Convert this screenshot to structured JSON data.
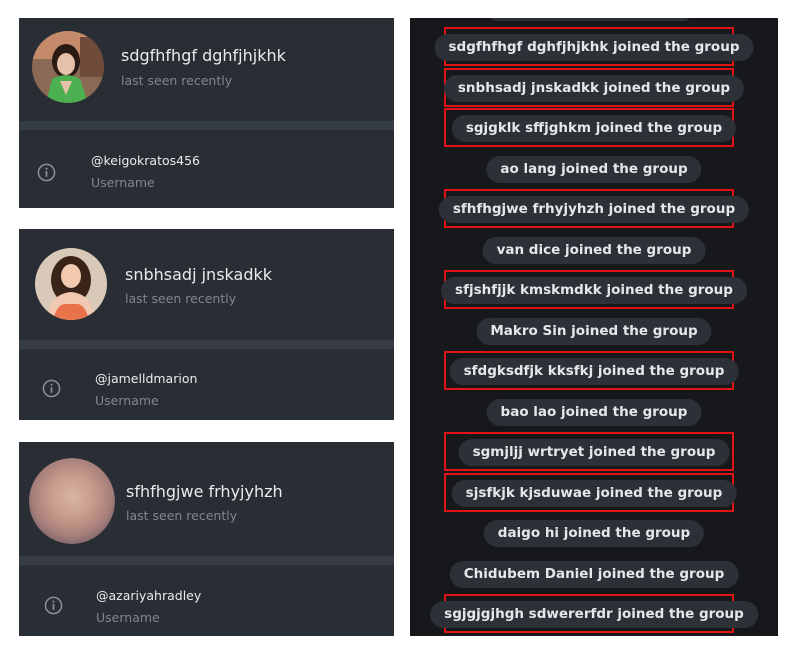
{
  "profiles": [
    {
      "name": "sdgfhfhgf dghfjhjkhk",
      "status": "last seen recently",
      "handle": "@keigokratos456",
      "handle_label": "Username"
    },
    {
      "name": "snbhsadj jnskadkk",
      "status": "last seen recently",
      "handle": "@jamelldmarion",
      "handle_label": "Username"
    },
    {
      "name": "sfhfhgjwe frhyjyhzh",
      "status": "last seen recently",
      "handle": "@azariyahradley",
      "handle_label": "Username"
    }
  ],
  "messages": [
    {
      "text": "sdgfhfhgf dghfjhjkhk joined the group",
      "highlighted": true
    },
    {
      "text": "snbhsadj jnskadkk joined the group",
      "highlighted": true
    },
    {
      "text": "sgjgklk sffjghkm joined the group",
      "highlighted": true
    },
    {
      "text": "ao lang joined the group",
      "highlighted": false
    },
    {
      "text": "sfhfhgjwe frhyjyhzh joined the group",
      "highlighted": true
    },
    {
      "text": "van dice joined the group",
      "highlighted": false
    },
    {
      "text": "sfjshfjjk kmskmdkk joined the group",
      "highlighted": true
    },
    {
      "text": "Makro Sin joined the group",
      "highlighted": false
    },
    {
      "text": "sfdgksdfjk kksfkj joined the group",
      "highlighted": true
    },
    {
      "text": "bao lao joined the group",
      "highlighted": false
    },
    {
      "text": "sgmjljj wrtryet joined the group",
      "highlighted": true
    },
    {
      "text": "sjsfkjk kjsduwae joined the group",
      "highlighted": true
    },
    {
      "text": "daigo hi joined the group",
      "highlighted": false
    },
    {
      "text": "Chidubem Daniel joined the group",
      "highlighted": false
    },
    {
      "text": "sgjgjgjhgh sdwererfdr joined the group",
      "highlighted": true
    }
  ],
  "colors": {
    "highlight_border": "#e01414",
    "panel_bg": "#292e34",
    "chat_bg": "#16181b",
    "pill_bg": "#2c3138"
  },
  "icons": {
    "info": "info-circle-icon"
  }
}
